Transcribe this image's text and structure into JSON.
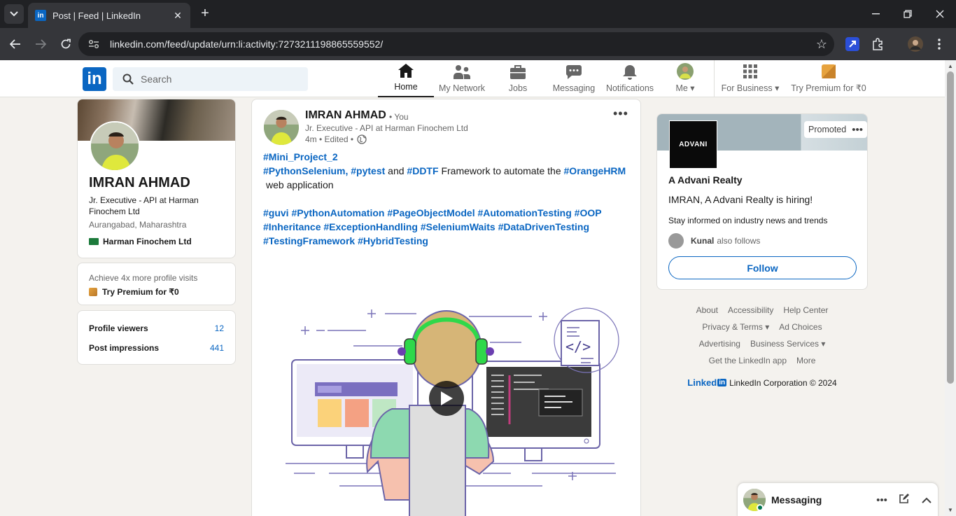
{
  "browser": {
    "tab_title": "Post | Feed | LinkedIn",
    "url": "linkedin.com/feed/update/urn:li:activity:7273211198865559552/"
  },
  "header": {
    "search_placeholder": "Search",
    "nav": [
      {
        "label": "Home",
        "icon": "home-icon"
      },
      {
        "label": "My Network",
        "icon": "network-icon"
      },
      {
        "label": "Jobs",
        "icon": "briefcase-icon"
      },
      {
        "label": "Messaging",
        "icon": "chat-icon"
      },
      {
        "label": "Notifications",
        "icon": "bell-icon"
      },
      {
        "label": "Me",
        "icon": "avatar"
      },
      {
        "label": "For Business",
        "icon": "grid-icon"
      },
      {
        "label": "Try Premium for ₹0",
        "icon": "premium-icon"
      }
    ]
  },
  "profile": {
    "name": "IMRAN AHMAD",
    "headline": "Jr. Executive - API at Harman Finochem Ltd",
    "location": "Aurangabad, Maharashtra",
    "company": "Harman Finochem Ltd"
  },
  "premium": {
    "hint": "Achieve 4x more profile visits",
    "cta": "Try Premium for ₹0"
  },
  "stats": [
    {
      "label": "Profile viewers",
      "value": "12"
    },
    {
      "label": "Post impressions",
      "value": "441"
    }
  ],
  "post": {
    "author": "IMRAN AHMAD",
    "you": "• You",
    "headline": "Jr. Executive - API at Harman Finochem Ltd",
    "meta": "4m • Edited •",
    "line1_tag": "#Mini_Project_2",
    "line2_tag1": "#PythonSelenium,",
    "line2_tag2": "#pytest",
    "line2_and": "and",
    "line2_tag3": "#DDTF",
    "line2_text": "Framework to automate the",
    "line2_tag4": "#OrangeHRM",
    "line3_text": "web application",
    "tags_block": "#guvi #PythonAutomation #PageObjectModel #AutomationTesting #OOP #Inheritance #ExceptionHandling #SeleniumWaits #DataDrivenTesting #TestingFramework #HybridTesting"
  },
  "ad": {
    "promoted": "Promoted",
    "logo_text": "ADVANI",
    "company": "A Advani Realty",
    "message": "IMRAN, A Advani Realty is hiring!",
    "sub": "Stay informed on industry news and trends",
    "follower_name": "Kunal",
    "follower_text": "also follows",
    "follow_label": "Follow"
  },
  "footer": {
    "about": "About",
    "accessibility": "Accessibility",
    "help": "Help Center",
    "privacy": "Privacy & Terms",
    "adchoices": "Ad Choices",
    "advertising": "Advertising",
    "business": "Business Services",
    "getapp": "Get the LinkedIn app",
    "more": "More",
    "logo_word": "Linked",
    "copyright": "LinkedIn Corporation © 2024"
  },
  "messaging": {
    "title": "Messaging"
  }
}
